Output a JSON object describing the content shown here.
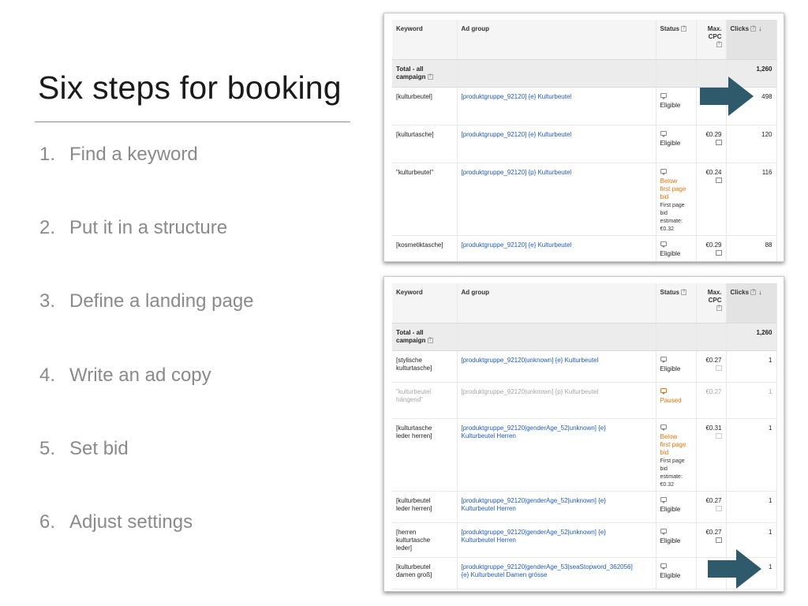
{
  "slide": {
    "title": "Six steps for booking",
    "steps": [
      {
        "num": "1.",
        "text": "Find a keyword"
      },
      {
        "num": "2.",
        "text": "Put it in a structure"
      },
      {
        "num": "3.",
        "text": "Define a landing page"
      },
      {
        "num": "4.",
        "text": "Write an ad copy"
      },
      {
        "num": "5.",
        "text": "Set bid"
      },
      {
        "num": "6.",
        "text": "Adjust settings"
      }
    ]
  },
  "columns": {
    "keyword": "Keyword",
    "ad_group": "Ad group",
    "status": "Status",
    "max_cpc_1": "Max.",
    "max_cpc_2": "CPC",
    "clicks": "Clicks",
    "sort_icon": "down-arrow-icon",
    "help": "?"
  },
  "table1": {
    "total_label_1": "Total - all",
    "total_label_2": "campaign",
    "total_clicks": "1,260",
    "rows": [
      {
        "keyword": "[kulturbeutel]",
        "ad_group": "[produktgruppe_92120] {e} Kulturbeutel",
        "status": "Eligible",
        "cpc": "",
        "clicks": "498"
      },
      {
        "keyword": "[kulturtasche]",
        "ad_group": "[produktgruppe_92120] {e} Kulturbeutel",
        "status": "Eligible",
        "cpc": "€0.29",
        "clicks": "120"
      },
      {
        "keyword": "\"kulturbeutel\"",
        "ad_group": "[produktgruppe_92120] {p} Kulturbeutel",
        "status_w1": "Below",
        "status_w2": "first page",
        "status_w3": "bid",
        "est1": "First page",
        "est2": "bid",
        "est3": "estimate:",
        "est4": "€0.32",
        "cpc": "€0.24",
        "clicks": "116"
      },
      {
        "keyword": "[kosmetiktasche]",
        "ad_group": "[produktgruppe_92120] {e} Kulturbeutel",
        "status": "Eligible",
        "cpc": "€0.29",
        "clicks": "88"
      }
    ]
  },
  "table2": {
    "total_label_1": "Total - all",
    "total_label_2": "campaign",
    "total_clicks": "1,260",
    "rows": [
      {
        "kw1": "[stylische",
        "kw2": "kulturtasche]",
        "ad_group": "[produktgruppe_92120|unknown] {e} Kulturbeutel",
        "status": "Eligible",
        "cpc": "€0.27",
        "clicks": "1"
      },
      {
        "kw1": "\"kulturbeutel",
        "kw2": "hängend\"",
        "ad_group": "[produktgruppe_92120|unknown] {p} Kulturbeutel",
        "status": "Paused",
        "cpc": "€0.27",
        "clicks": "1"
      },
      {
        "kw1": "[kulturtasche",
        "kw2": "leder herren]",
        "ag1": "[produktgruppe_92120|genderAge_52|unknown] {e}",
        "ag2": "Kulturbeutel Herren",
        "status_w1": "Below",
        "status_w2": "first page",
        "status_w3": "bid",
        "est1": "First page",
        "est2": "bid",
        "est3": "estimate:",
        "est4": "€0.32",
        "cpc": "€0.31",
        "clicks": "1"
      },
      {
        "kw1": "[kulturbeutel",
        "kw2": "leder herren]",
        "ag1": "[produktgruppe_92120|genderAge_52|unknown] {e}",
        "ag2": "Kulturbeutel Herren",
        "status": "Eligible",
        "cpc": "€0.27",
        "clicks": "1"
      },
      {
        "kw1": "[herren",
        "kw2": "kulturtasche",
        "kw3": "leder]",
        "ag1": "[produktgruppe_92120|genderAge_52|unknown] {e}",
        "ag2": "Kulturbeutel Herren",
        "status": "Eligible",
        "cpc": "€0.27",
        "clicks": "1"
      },
      {
        "kw1": "[kulturbeutel",
        "kw2": "damen groß]",
        "ag1": "[produktgruppe_92120|genderAge_53|seaStopword_362056]",
        "ag2": "{e} Kulturbeutel Damen grösse",
        "status": "Eligible",
        "cpc": "",
        "clicks": "1"
      }
    ]
  },
  "colors": {
    "arrow": "#2e5a6b",
    "link": "#1f5bb8",
    "warning": "#e8740d"
  }
}
